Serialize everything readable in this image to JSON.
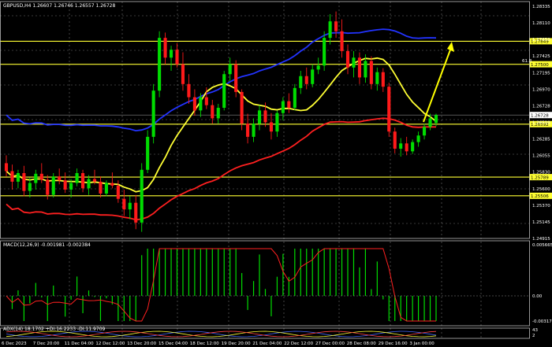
{
  "header": {
    "symbol_line": "GBPUSD,H4  1.26607 1.26746 1.26557 1.26728",
    "macd_label": "MACD(12,26,9) -0.001981 -0.002384",
    "adx_label": "ADX(14) 18.1702 +DI:16.2233 -DI:11.9709"
  },
  "colors": {
    "background": "#000000",
    "bull": "#00dd00",
    "bear": "#ff1a1a",
    "ma_fast": "#ffff33",
    "ma_slow": "#ff2020",
    "ma_upper": "#2233ff",
    "level": "#ffff33",
    "grid": "#cfcfcf",
    "arrow": "#ffff00"
  },
  "price_axis": [
    "1.28335",
    "1.28110",
    "1.27650",
    "1.27425",
    "1.27195",
    "1.26970",
    "1.26728",
    "1.26510",
    "1.26285",
    "1.26055",
    "1.25830",
    "1.25600",
    "1.25370",
    "1.25145",
    "1.24915"
  ],
  "fib_label": "61.8",
  "levels": [
    {
      "tag": "1.27849",
      "value": 1.27849
    },
    {
      "tag": "1.27500",
      "value": 1.275
    },
    {
      "tag": "1.26592",
      "value": 1.26592
    },
    {
      "tag": "1.25789",
      "value": 1.25789
    },
    {
      "tag": "1.25506",
      "value": 1.25506
    }
  ],
  "current_price_tag": "1.26728",
  "macd_axis": [
    "0.005665",
    "0.00",
    "-0.003171"
  ],
  "adx_axis": [
    "43",
    "2"
  ],
  "time_axis": [
    "6 Dec 2023",
    "7 Dec 20:00",
    "11 Dec 04:00",
    "12 Dec 12:00",
    "13 Dec 20:00",
    "15 Dec 04:00",
    "18 Dec 12:00",
    "19 Dec 20:00",
    "21 Dec 04:00",
    "22 Dec 12:00",
    "27 Dec 00:00",
    "28 Dec 08:00",
    "29 Dec 16:00",
    "3 Jan 00:00"
  ],
  "chart_data": {
    "type": "candlestick",
    "symbol": "GBPUSD",
    "timeframe": "H4",
    "ylim": [
      1.2486,
      1.2845
    ],
    "candles": [
      [
        1.26,
        1.2612,
        1.258,
        1.2588
      ],
      [
        1.2588,
        1.2598,
        1.256,
        1.2572
      ],
      [
        1.2572,
        1.259,
        1.2562,
        1.2585
      ],
      [
        1.2585,
        1.2596,
        1.255,
        1.2558
      ],
      [
        1.2558,
        1.2578,
        1.2548,
        1.257
      ],
      [
        1.257,
        1.259,
        1.256,
        1.2584
      ],
      [
        1.2584,
        1.26,
        1.257,
        1.2575
      ],
      [
        1.2575,
        1.2582,
        1.2545,
        1.2552
      ],
      [
        1.2552,
        1.2585,
        1.2548,
        1.258
      ],
      [
        1.258,
        1.2592,
        1.2568,
        1.2574
      ],
      [
        1.2574,
        1.2586,
        1.2555,
        1.256
      ],
      [
        1.256,
        1.2576,
        1.2548,
        1.257
      ],
      [
        1.257,
        1.2592,
        1.2565,
        1.2585
      ],
      [
        1.2585,
        1.259,
        1.2556,
        1.2562
      ],
      [
        1.2562,
        1.2582,
        1.2552,
        1.2576
      ],
      [
        1.2576,
        1.259,
        1.2568,
        1.2572
      ],
      [
        1.2572,
        1.258,
        1.2548,
        1.2554
      ],
      [
        1.2554,
        1.2574,
        1.255,
        1.257
      ],
      [
        1.257,
        1.2586,
        1.2562,
        1.2566
      ],
      [
        1.2566,
        1.2574,
        1.254,
        1.2546
      ],
      [
        1.2546,
        1.256,
        1.252,
        1.253
      ],
      [
        1.253,
        1.255,
        1.2515,
        1.254
      ],
      [
        1.254,
        1.2552,
        1.25,
        1.251
      ],
      [
        1.251,
        1.26,
        1.2496,
        1.259
      ],
      [
        1.259,
        1.265,
        1.2585,
        1.264
      ],
      [
        1.264,
        1.272,
        1.263,
        1.271
      ],
      [
        1.271,
        1.28,
        1.27,
        1.279
      ],
      [
        1.279,
        1.2798,
        1.275,
        1.276
      ],
      [
        1.276,
        1.2778,
        1.274,
        1.2772
      ],
      [
        1.2772,
        1.2782,
        1.2745,
        1.275
      ],
      [
        1.275,
        1.2768,
        1.271,
        1.272
      ],
      [
        1.272,
        1.2735,
        1.269,
        1.27
      ],
      [
        1.27,
        1.2712,
        1.2672,
        1.268
      ],
      [
        1.268,
        1.2706,
        1.267,
        1.27
      ],
      [
        1.27,
        1.2715,
        1.2682,
        1.2688
      ],
      [
        1.2688,
        1.2696,
        1.266,
        1.2668
      ],
      [
        1.2668,
        1.269,
        1.266,
        1.2684
      ],
      [
        1.2684,
        1.274,
        1.268,
        1.2735
      ],
      [
        1.2735,
        1.276,
        1.2725,
        1.275
      ],
      [
        1.275,
        1.2756,
        1.27,
        1.2708
      ],
      [
        1.2708,
        1.2712,
        1.265,
        1.266
      ],
      [
        1.266,
        1.2675,
        1.263,
        1.264
      ],
      [
        1.264,
        1.2668,
        1.2632,
        1.266
      ],
      [
        1.266,
        1.2688,
        1.265,
        1.268
      ],
      [
        1.268,
        1.2692,
        1.2655,
        1.2662
      ],
      [
        1.2662,
        1.2676,
        1.2636,
        1.2648
      ],
      [
        1.2648,
        1.268,
        1.264,
        1.2676
      ],
      [
        1.2676,
        1.27,
        1.2665,
        1.2694
      ],
      [
        1.2694,
        1.2706,
        1.2676,
        1.2684
      ],
      [
        1.2684,
        1.272,
        1.268,
        1.2714
      ],
      [
        1.2714,
        1.274,
        1.2705,
        1.2732
      ],
      [
        1.2732,
        1.2745,
        1.2712,
        1.272
      ],
      [
        1.272,
        1.275,
        1.2715,
        1.2742
      ],
      [
        1.2742,
        1.276,
        1.2735,
        1.2748
      ],
      [
        1.2748,
        1.28,
        1.274,
        1.279
      ],
      [
        1.279,
        1.2826,
        1.278,
        1.2815
      ],
      [
        1.2815,
        1.283,
        1.279,
        1.28
      ],
      [
        1.28,
        1.2818,
        1.276,
        1.277
      ],
      [
        1.277,
        1.278,
        1.2735,
        1.2745
      ],
      [
        1.2745,
        1.277,
        1.273,
        1.276
      ],
      [
        1.276,
        1.2768,
        1.272,
        1.273
      ],
      [
        1.273,
        1.2765,
        1.2722,
        1.2755
      ],
      [
        1.2755,
        1.2762,
        1.2712,
        1.272
      ],
      [
        1.272,
        1.2745,
        1.271,
        1.2738
      ],
      [
        1.2738,
        1.2744,
        1.2708,
        1.2716
      ],
      [
        1.2716,
        1.2722,
        1.264,
        1.2648
      ],
      [
        1.2648,
        1.2654,
        1.2615,
        1.2622
      ],
      [
        1.2622,
        1.2638,
        1.261,
        1.263
      ],
      [
        1.263,
        1.264,
        1.2612,
        1.2618
      ],
      [
        1.2618,
        1.2636,
        1.2614,
        1.2632
      ],
      [
        1.2632,
        1.2648,
        1.2625,
        1.2642
      ],
      [
        1.2642,
        1.266,
        1.2636,
        1.2655
      ],
      [
        1.2655,
        1.2675,
        1.265,
        1.2668
      ],
      [
        1.2661,
        1.2675,
        1.2656,
        1.2673
      ]
    ]
  }
}
